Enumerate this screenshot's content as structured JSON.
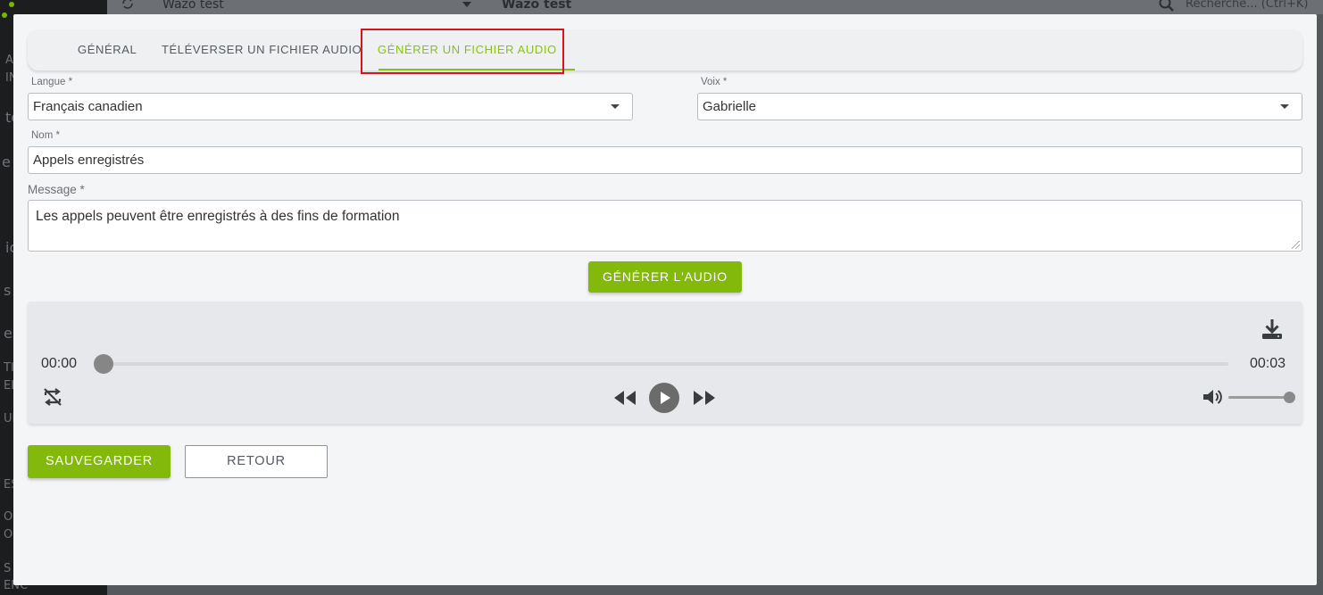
{
  "background": {
    "topbar_selector_value": "Wazo test",
    "topbar_title": "Wazo test",
    "search_placeholder": "Recherche... (Ctrl+K)",
    "sidebar_fragments": [
      "AU",
      "IN",
      "te",
      "e c",
      "ic",
      "s",
      "es",
      "TIC",
      "ELL",
      "UE",
      "ES",
      "ÔO",
      "OU",
      "S D",
      "ENCE"
    ]
  },
  "tabs": [
    {
      "label": "Général",
      "active": false
    },
    {
      "label": "Téléverser un fichier audio",
      "active": false
    },
    {
      "label": "Générer un fichier audio",
      "active": true
    }
  ],
  "form": {
    "language": {
      "label": "Langue *",
      "value": "Français canadien"
    },
    "voice": {
      "label": "Voix *",
      "value": "Gabrielle"
    },
    "name": {
      "label": "Nom *",
      "value": "Appels enregistrés"
    },
    "message": {
      "label": "Message *",
      "value": "Les appels peuvent être enregistrés à des fins de formation"
    }
  },
  "generate_button": "Générer l'audio",
  "player": {
    "current_time": "00:00",
    "duration": "00:03",
    "progress_fraction": 0,
    "volume_fraction": 1
  },
  "actions": {
    "save": "SAUVEGARDER",
    "back": "RETOUR"
  },
  "colors": {
    "accent": "#82b90a",
    "active_tab": "#8cc20f",
    "highlight": "#d9151b"
  },
  "icons": [
    "refresh-icon",
    "chevron-down-icon",
    "search-icon",
    "download-icon",
    "repeat-off-icon",
    "rewind-icon",
    "play-icon",
    "fast-forward-icon",
    "volume-icon"
  ]
}
